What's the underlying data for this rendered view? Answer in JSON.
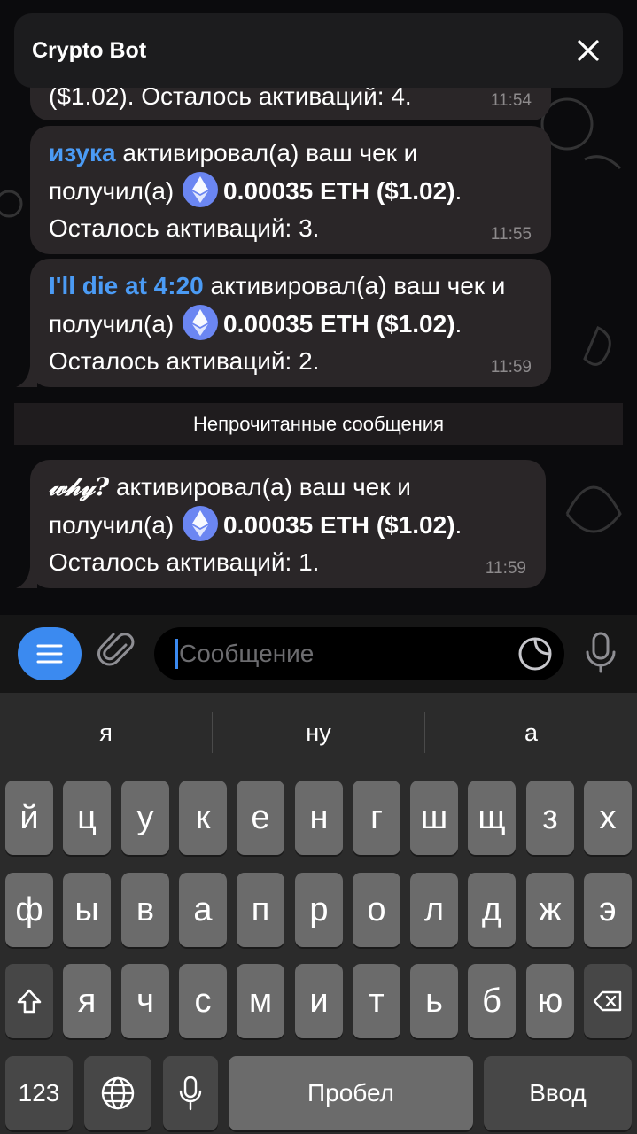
{
  "header": {
    "title": "Crypto Bot"
  },
  "partial_message": {
    "text": "($1.02). Осталось активаций: 4.",
    "time": "11:54"
  },
  "messages": [
    {
      "name": "изука",
      "text_a": " активировал(а) ваш чек и получил(а) ",
      "amount": "0.00035 ETH",
      "usd": "($1.02)",
      "rest": ". Осталось активаций: 3.",
      "time": "11:55"
    },
    {
      "name": "I'll die at 4:20",
      "text_a": " активировал(а) ваш чек и получил(а) ",
      "amount": "0.00035 ETH",
      "usd": "($1.02)",
      "rest": ". Осталось активаций: 2.",
      "time": "11:59"
    },
    {
      "name": "𝓌𝒽𝓎?",
      "text_a": " активировал(а) ваш чек и получил(а) ",
      "amount": "0.00035 ETH",
      "usd": "($1.02)",
      "rest": ". Осталось активаций: 1.",
      "time": "11:59"
    }
  ],
  "unread_divider": "Непрочитанные сообщения",
  "composer": {
    "placeholder": "Сообщение"
  },
  "keyboard": {
    "suggestions": [
      "я",
      "ну",
      "а"
    ],
    "row1": [
      "й",
      "ц",
      "у",
      "к",
      "е",
      "н",
      "г",
      "ш",
      "щ",
      "з",
      "х"
    ],
    "row2": [
      "ф",
      "ы",
      "в",
      "а",
      "п",
      "р",
      "о",
      "л",
      "д",
      "ж",
      "э"
    ],
    "row3": [
      "я",
      "ч",
      "с",
      "м",
      "и",
      "т",
      "ь",
      "б",
      "ю"
    ],
    "numbers_key": "123",
    "space_key": "Пробел",
    "return_key": "Ввод"
  },
  "colors": {
    "accent": "#3b8af0",
    "name_link": "#4b9bf5",
    "bubble": "#2a2628",
    "eth_badge": "#6b86f2"
  },
  "icons": [
    "close-icon",
    "menu-icon",
    "paperclip-icon",
    "sticker-icon",
    "microphone-icon",
    "ethereum-icon",
    "shift-icon",
    "backspace-icon",
    "globe-icon",
    "dictation-icon"
  ]
}
